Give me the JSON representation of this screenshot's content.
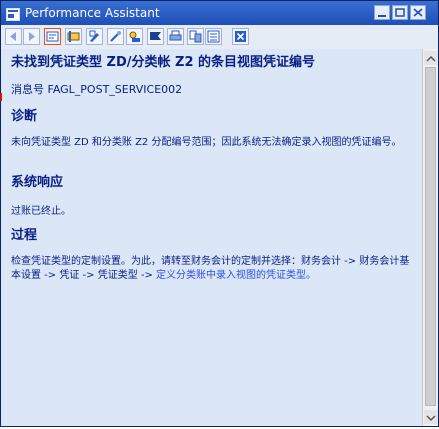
{
  "window": {
    "title": "Performance Assistant",
    "controls": [
      "minimize",
      "maximize",
      "close"
    ]
  },
  "toolbar": {
    "buttons": [
      {
        "name": "back-icon"
      },
      {
        "name": "forward-icon"
      },
      {
        "name": "technical-info-icon"
      },
      {
        "name": "display-icon"
      },
      {
        "name": "edit-icon"
      },
      {
        "name": "tools-icon"
      },
      {
        "name": "bookmark-icon"
      },
      {
        "name": "flag-icon"
      },
      {
        "name": "print-icon"
      },
      {
        "name": "transfer-icon"
      },
      {
        "name": "settings-icon"
      },
      {
        "name": "close-doc-icon"
      }
    ]
  },
  "doc": {
    "title": "未找到凭证类型 ZD/分类帐 Z2 的条目视图凭证编号",
    "message_no": "消息号 FAGL_POST_SERVICE002",
    "diagnosis_heading": "诊断",
    "diagnosis_text": "未向凭证类型 ZD 和分类账 Z2 分配编号范围；因此系统无法确定录入视图的凭证编号。",
    "response_heading": "系统响应",
    "response_text": "过账已终止。",
    "procedure_heading": "过程",
    "procedure_text": "检查凭证类型的定制设置。为此，请转至财务会计的定制并选择：财务会计 -> 财务会计基本设置 -> 凭证 -> 凭证类型 -> ",
    "procedure_link": "定义分类账中录入视图的凭证类型。"
  },
  "colors": {
    "title_bar": "#1e4fb7",
    "content_bg": "#dbe6f7",
    "text": "#0a1f84",
    "link": "#2f4fe0"
  }
}
